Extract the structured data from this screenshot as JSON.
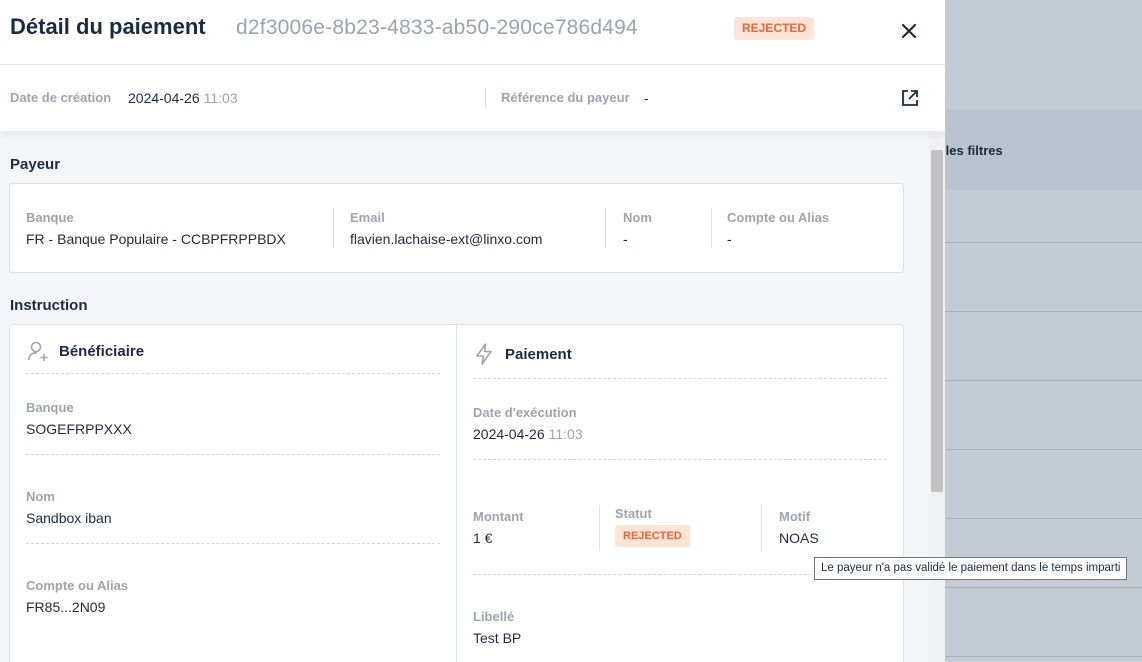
{
  "background": {
    "filter_text": "r les filtres"
  },
  "header": {
    "title": "Détail du paiement",
    "payment_id": "d2f3006e-8b23-4833-ab50-290ce786d494",
    "status": "REJECTED",
    "created_label": "Date de création",
    "created_date": "2024-04-26",
    "created_time": "11:03",
    "payer_ref_label": "Référence du payeur",
    "payer_ref_value": "-"
  },
  "payer": {
    "section_title": "Payeur",
    "bank_label": "Banque",
    "bank_value": "FR - Banque Populaire - CCBPFRPPBDX",
    "email_label": "Email",
    "email_value": "flavien.lachaise-ext@linxo.com",
    "name_label": "Nom",
    "name_value": "-",
    "account_label": "Compte ou Alias",
    "account_value": "-"
  },
  "instruction": {
    "section_title": "Instruction",
    "beneficiary": {
      "title": "Bénéficiaire",
      "bank_label": "Banque",
      "bank_value": "SOGEFRPPXXX",
      "name_label": "Nom",
      "name_value": "Sandbox iban",
      "account_label": "Compte ou Alias",
      "account_value": "FR85...2N09"
    },
    "payment": {
      "title": "Paiement",
      "exec_label": "Date d'exécution",
      "exec_date": "2024-04-26",
      "exec_time": "11:03",
      "amount_label": "Montant",
      "amount_value": "1 €",
      "status_label": "Statut",
      "status_value": "REJECTED",
      "reason_label": "Motif",
      "reason_value": "NOAS",
      "label_label": "Libellé",
      "label_value": "Test BP"
    }
  },
  "tooltip": {
    "text": "Le payeur n'a pas validé le paiement dans le temps imparti"
  },
  "colors": {
    "rejected_bg": "#fde4d6",
    "rejected_text": "#e8663d",
    "title": "#1c2b45",
    "muted": "#9ba4b0"
  }
}
